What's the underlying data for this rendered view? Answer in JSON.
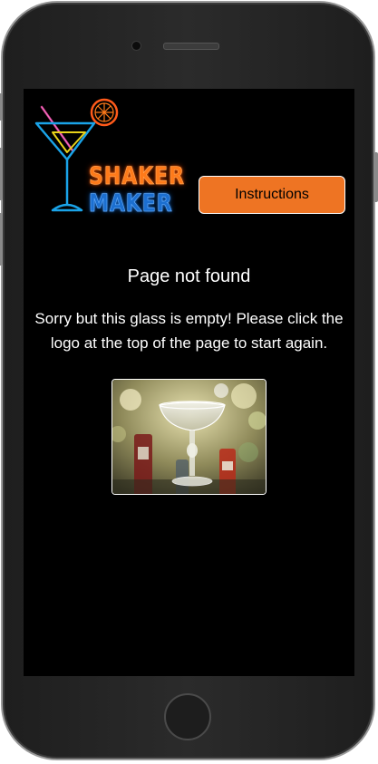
{
  "app": {
    "logo_text_top": "SHAKER",
    "logo_text_bottom": "MAKER"
  },
  "header": {
    "instructions_label": "Instructions"
  },
  "main": {
    "title": "Page not found",
    "message": "Sorry but this glass is empty! Please click the logo at the top of the page to start again."
  },
  "colors": {
    "accent": "#ee7423",
    "background": "#000000",
    "text": "#ffffff",
    "logo_orange": "#ff7a1a",
    "logo_blue": "#1c6fd0"
  },
  "icons": {
    "logo": "cocktail-glass-neon-icon",
    "photo": "coupe-glass-photo"
  }
}
